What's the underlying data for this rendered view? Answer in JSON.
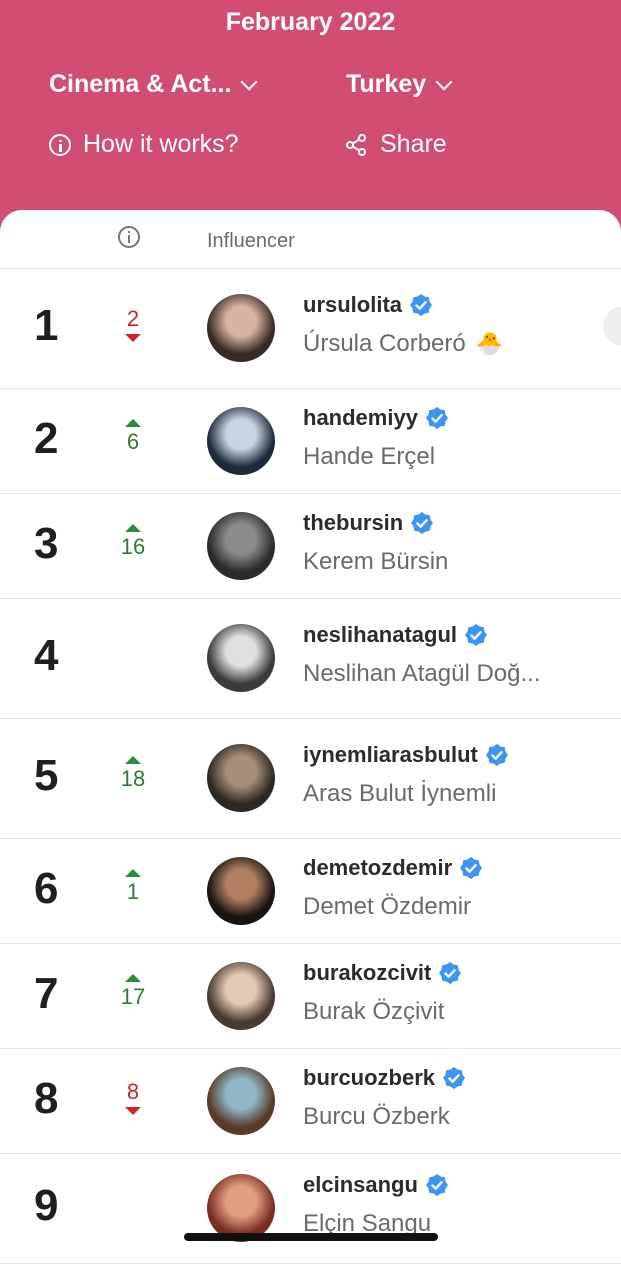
{
  "header": {
    "month": "February 2022",
    "category": "Cinema & Act...",
    "country": "Turkey",
    "how_it_works": "How it works?",
    "share": "Share"
  },
  "table": {
    "col_influencer": "Influencer"
  },
  "rows": [
    {
      "rank": "1",
      "change": "2",
      "direction": "down",
      "username": "ursulolita",
      "fullname": "Úrsula Corberó",
      "emoji": "🐣",
      "avatar_colors": [
        "#3a2a24",
        "#d7b3a0"
      ]
    },
    {
      "rank": "2",
      "change": "6",
      "direction": "up",
      "username": "handemiyy",
      "fullname": "Hande Erçel",
      "emoji": "",
      "avatar_colors": [
        "#1d2a3a",
        "#c9d4e2"
      ]
    },
    {
      "rank": "3",
      "change": "16",
      "direction": "up",
      "username": "thebursin",
      "fullname": "Kerem Bürsin",
      "emoji": "",
      "avatar_colors": [
        "#2b2b2b",
        "#8c8c8c"
      ]
    },
    {
      "rank": "4",
      "change": "",
      "direction": "none",
      "username": "neslihanatagul",
      "fullname": "Neslihan Atagül Doğ...",
      "emoji": "",
      "avatar_colors": [
        "#3b3b3b",
        "#e0e0e0"
      ]
    },
    {
      "rank": "5",
      "change": "18",
      "direction": "up",
      "username": "iynemliarasbulut",
      "fullname": "Aras Bulut İynemli",
      "emoji": "",
      "avatar_colors": [
        "#2d2824",
        "#a88e78"
      ]
    },
    {
      "rank": "6",
      "change": "1",
      "direction": "up",
      "username": "demetozdemir",
      "fullname": "Demet Özdemir",
      "emoji": "",
      "avatar_colors": [
        "#1a1412",
        "#b08060"
      ]
    },
    {
      "rank": "7",
      "change": "17",
      "direction": "up",
      "username": "burakozcivit",
      "fullname": "Burak Özçivit",
      "emoji": "",
      "avatar_colors": [
        "#4a3a30",
        "#e4c8b4"
      ]
    },
    {
      "rank": "8",
      "change": "8",
      "direction": "down",
      "username": "burcuozberk",
      "fullname": "Burcu Özberk",
      "emoji": "",
      "avatar_colors": [
        "#5a3a28",
        "#8fb7c8"
      ]
    },
    {
      "rank": "9",
      "change": "",
      "direction": "none",
      "username": "elcinsangu",
      "fullname": "Elçin Sangu",
      "emoji": "",
      "avatar_colors": [
        "#7a2e24",
        "#e0a080"
      ]
    }
  ],
  "colors": {
    "header_bg": "#d14d72",
    "up": "#2e7d32",
    "down": "#c62828",
    "verified": "#3d95f0"
  }
}
